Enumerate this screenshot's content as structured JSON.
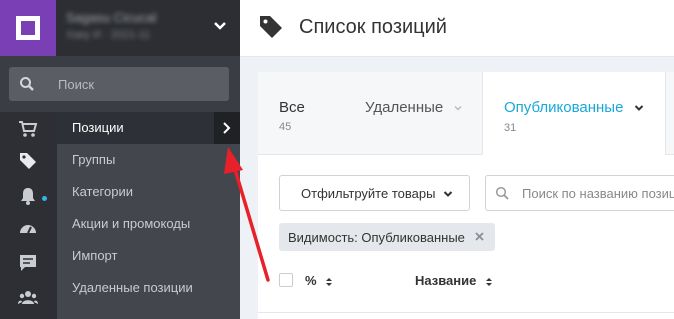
{
  "sidebar": {
    "account": {
      "name": "Sagasu Cicucal",
      "sub": "Хаку И · 2021-11"
    },
    "search_placeholder": "Поиск",
    "rail": [
      "cart-icon",
      "tag-icon",
      "bell-icon",
      "gauge-icon",
      "chat-icon",
      "users-icon"
    ],
    "submenu": {
      "active": "Позиции",
      "items": [
        "Группы",
        "Категории",
        "Акции и промокоды",
        "Импорт",
        "Удаленные позиции"
      ]
    }
  },
  "header": {
    "title": "Список позиций"
  },
  "tabs": {
    "all": {
      "label": "Все",
      "count": "45"
    },
    "deleted": {
      "label": "Удаленные"
    },
    "published": {
      "label": "Опубликованные",
      "count": "31"
    }
  },
  "toolbar": {
    "filter_label": "Отфильтруйте товары",
    "search_placeholder": "Поиск по названию позиции"
  },
  "chip": {
    "label": "Видимость: Опубликованные"
  },
  "table": {
    "columns": [
      "%",
      "Название"
    ]
  },
  "colors": {
    "brand": "#7b3fb5",
    "accent": "#1aa8d8",
    "annotation": "#e8202a"
  }
}
